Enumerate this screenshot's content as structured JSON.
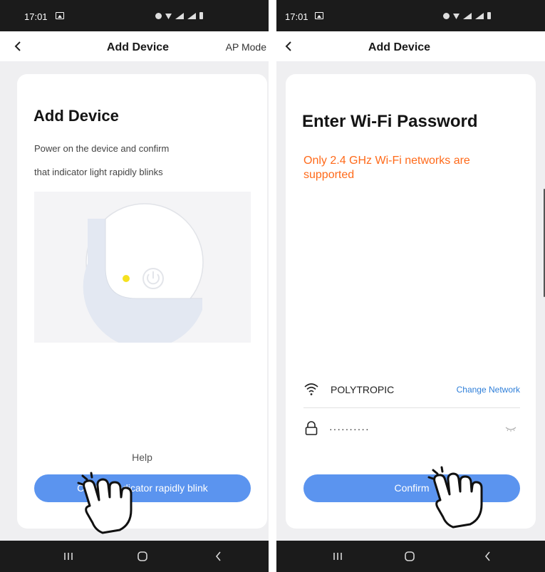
{
  "screens": [
    {
      "status": {
        "time": "17:01"
      },
      "header": {
        "title": "Add Device",
        "ap_mode": "AP Mode"
      },
      "content": {
        "heading": "Add Device",
        "desc_line1": "Power on the device and confirm",
        "desc_line2": "that indicator light rapidly blinks",
        "help": "Help",
        "button": "Confirm indicator rapidly blink"
      }
    },
    {
      "status": {
        "time": "17:01"
      },
      "header": {
        "title": "Add Device"
      },
      "content": {
        "heading": "Enter Wi-Fi Password",
        "note": "Only 2.4 GHz Wi-Fi networks are supported",
        "network_name": "POLYTROPIC",
        "change_network": "Change Network",
        "password_value": "··········",
        "button": "Confirm"
      }
    }
  ],
  "colors": {
    "accent": "#5b94ef",
    "warning": "#ff6a1a",
    "link": "#2f7fd9",
    "indicator": "#f5e11f",
    "system_bar": "#1b1b1b",
    "page_background": "#efeff1"
  },
  "icons": [
    "back-arrow-icon",
    "wifi-icon",
    "lock-icon",
    "eye-closed-icon",
    "power-icon",
    "recent-apps-icon",
    "home-icon",
    "nav-back-icon",
    "tap-hand-icon"
  ]
}
